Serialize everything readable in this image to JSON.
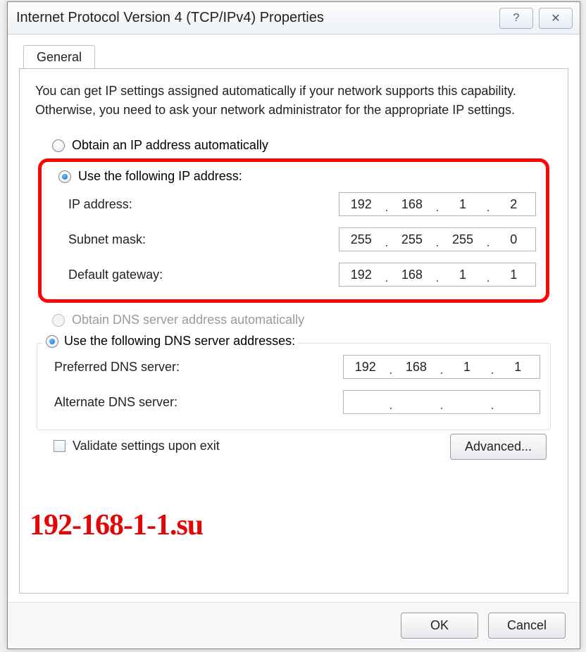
{
  "window": {
    "title": "Internet Protocol Version 4 (TCP/IPv4) Properties",
    "help_symbol": "?",
    "close_symbol": "✕"
  },
  "tab": {
    "general": "General"
  },
  "info_text": "You can get IP settings assigned automatically if your network supports this capability. Otherwise, you need to ask your network administrator for the appropriate IP settings.",
  "ip_section": {
    "auto_label": "Obtain an IP address automatically",
    "manual_label": "Use the following IP address:",
    "ip_label": "IP address:",
    "ip_value": {
      "a": "192",
      "b": "168",
      "c": "1",
      "d": "2"
    },
    "mask_label": "Subnet mask:",
    "mask_value": {
      "a": "255",
      "b": "255",
      "c": "255",
      "d": "0"
    },
    "gw_label": "Default gateway:",
    "gw_value": {
      "a": "192",
      "b": "168",
      "c": "1",
      "d": "1"
    }
  },
  "dns_section": {
    "auto_label": "Obtain DNS server address automatically",
    "manual_label": "Use the following DNS server addresses:",
    "pref_label": "Preferred DNS server:",
    "pref_value": {
      "a": "192",
      "b": "168",
      "c": "1",
      "d": "1"
    },
    "alt_label": "Alternate DNS server:",
    "alt_value": {
      "a": "",
      "b": "",
      "c": "",
      "d": ""
    }
  },
  "validate_label": "Validate settings upon exit",
  "advanced_label": "Advanced...",
  "ok_label": "OK",
  "cancel_label": "Cancel",
  "watermark": "192-168-1-1.su"
}
